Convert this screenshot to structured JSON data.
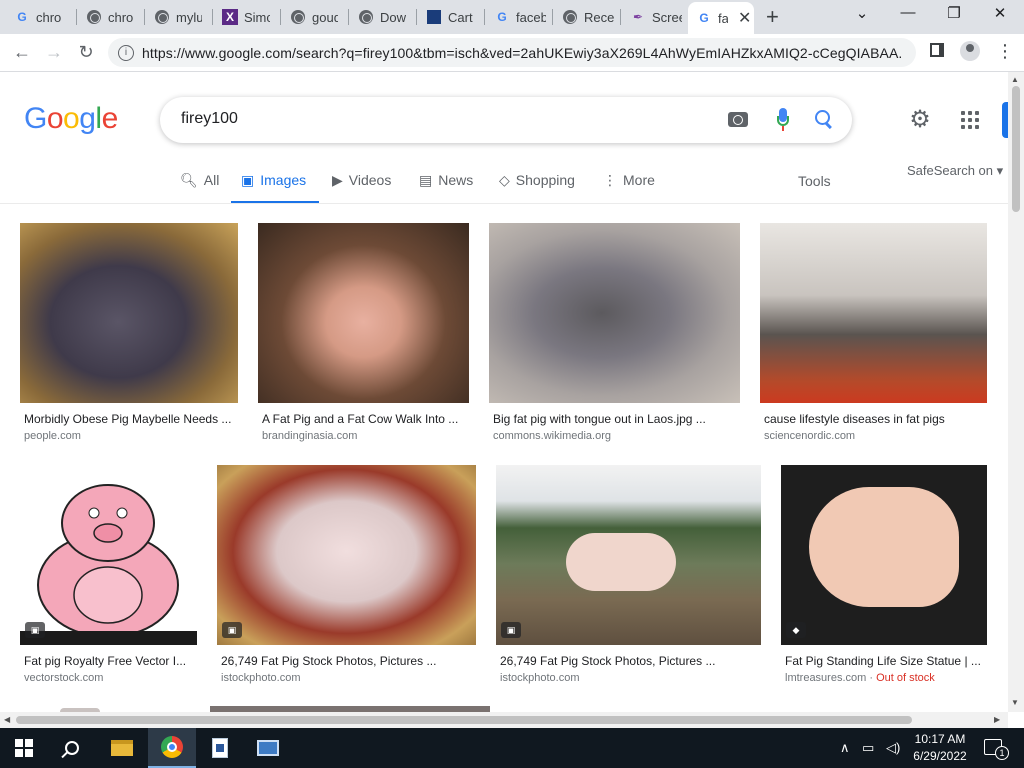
{
  "browser": {
    "tabs": [
      {
        "title": "chron",
        "icon": "g-favicon"
      },
      {
        "title": "chron",
        "icon": "globe-favicon"
      },
      {
        "title": "myluc",
        "icon": "globe-favicon"
      },
      {
        "title": "Simc",
        "icon": "purple-favicon"
      },
      {
        "title": "goud",
        "icon": "globe-favicon"
      },
      {
        "title": "Down",
        "icon": "globe-favicon"
      },
      {
        "title": "Cart",
        "icon": "chart-favicon"
      },
      {
        "title": "faceb",
        "icon": "g-favicon"
      },
      {
        "title": "Recen",
        "icon": "globe-favicon"
      },
      {
        "title": "Scree",
        "icon": "feather-favicon"
      },
      {
        "title": "fa",
        "icon": "g-favicon",
        "active": true
      }
    ],
    "new_tab_label": "+",
    "window_controls": {
      "tab_search": "⌄",
      "minimize": "—",
      "restore": "❐",
      "close": "✕"
    },
    "url": "https://www.google.com/search?q=firey100&tbm=isch&ved=2ahUKEwiy3aX269L4AhWyEmIAHZkxAMIQ2-cCegQIABAA..."
  },
  "google": {
    "logo": [
      "G",
      "o",
      "o",
      "g",
      "l",
      "e"
    ],
    "logo_colors": [
      "#4285f4",
      "#ea4335",
      "#fbbc05",
      "#4285f4",
      "#34a853",
      "#ea4335"
    ],
    "query": "firey100",
    "tabs": [
      {
        "label": "All",
        "icon": "search-icon"
      },
      {
        "label": "Images",
        "icon": "image-icon",
        "active": true
      },
      {
        "label": "Videos",
        "icon": "video-icon"
      },
      {
        "label": "News",
        "icon": "news-icon"
      },
      {
        "label": "Shopping",
        "icon": "tag-icon"
      },
      {
        "label": "More",
        "icon": "more-vert-icon"
      }
    ],
    "tools_label": "Tools",
    "safesearch_label": "SafeSearch on ▾"
  },
  "results": [
    {
      "title": "Morbidly Obese Pig Maybelle Needs ...",
      "source": "people.com",
      "badge": ""
    },
    {
      "title": "A Fat Pig and a Fat Cow Walk Into ...",
      "source": "brandinginasia.com",
      "badge": ""
    },
    {
      "title": "Big fat pig with tongue out in Laos.jpg ...",
      "source": "commons.wikimedia.org",
      "badge": ""
    },
    {
      "title": "cause lifestyle diseases in fat pigs",
      "source": "sciencenordic.com",
      "badge": ""
    },
    {
      "title": "Fat pig Royalty Free Vector I...",
      "source": "vectorstock.com",
      "badge": "image"
    },
    {
      "title": "26,749 Fat Pig Stock Photos, Pictures ...",
      "source": "istockphoto.com",
      "badge": "image"
    },
    {
      "title": "26,749 Fat Pig Stock Photos, Pictures ...",
      "source": "istockphoto.com",
      "badge": "image"
    },
    {
      "title": "Fat Pig Standing Life Size Statue | ...",
      "source": "lmtreasures.com",
      "source_extra": "Out of stock",
      "badge": "tag"
    }
  ],
  "taskbar": {
    "time": "10:17 AM",
    "date": "6/29/2022",
    "notification_count": "1"
  }
}
